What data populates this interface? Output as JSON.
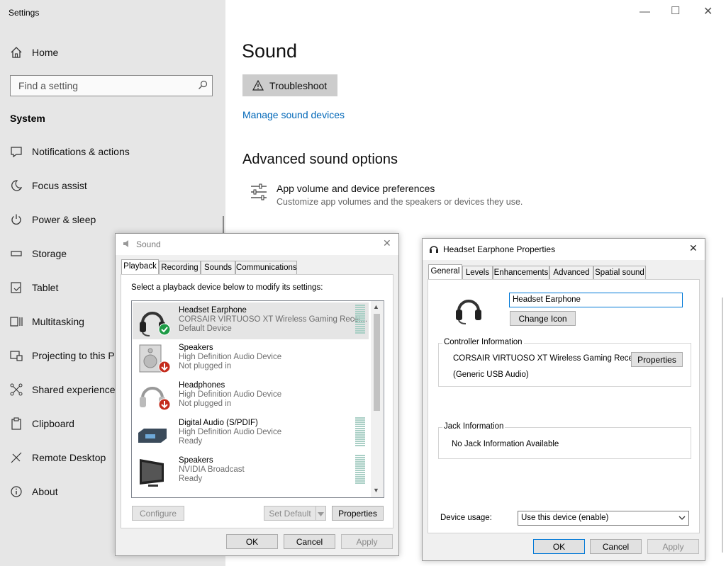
{
  "settings": {
    "app_title": "Settings",
    "home_label": "Home",
    "search_placeholder": "Find a setting",
    "section_title": "System",
    "nav_items": [
      {
        "label": "Notifications & actions",
        "icon": "notifications-icon"
      },
      {
        "label": "Focus assist",
        "icon": "moon-icon"
      },
      {
        "label": "Power & sleep",
        "icon": "power-icon"
      },
      {
        "label": "Storage",
        "icon": "storage-icon"
      },
      {
        "label": "Tablet",
        "icon": "tablet-icon"
      },
      {
        "label": "Multitasking",
        "icon": "multitasking-icon"
      },
      {
        "label": "Projecting to this PC",
        "icon": "projecting-icon"
      },
      {
        "label": "Shared experiences",
        "icon": "shared-icon"
      },
      {
        "label": "Clipboard",
        "icon": "clipboard-icon"
      },
      {
        "label": "Remote Desktop",
        "icon": "remote-desktop-icon"
      },
      {
        "label": "About",
        "icon": "info-icon"
      }
    ],
    "main": {
      "title": "Sound",
      "troubleshoot_label": "Troubleshoot",
      "manage_link": "Manage sound devices",
      "advanced_title": "Advanced sound options",
      "app_volume_title": "App volume and device preferences",
      "app_volume_subtitle": "Customize app volumes and the speakers or devices they use."
    }
  },
  "sound_dialog": {
    "title": "Sound",
    "tabs": [
      "Playback",
      "Recording",
      "Sounds",
      "Communications"
    ],
    "instruction": "Select a playback device below to modify its settings:",
    "devices": [
      {
        "name": "Headset Earphone",
        "subtitle": "CORSAIR VIRTUOSO XT Wireless Gaming Recei...",
        "status": "Default Device"
      },
      {
        "name": "Speakers",
        "subtitle": "High Definition Audio Device",
        "status": "Not plugged in"
      },
      {
        "name": "Headphones",
        "subtitle": "High Definition Audio Device",
        "status": "Not plugged in"
      },
      {
        "name": "Digital Audio (S/PDIF)",
        "subtitle": "High Definition Audio Device",
        "status": "Ready"
      },
      {
        "name": "Speakers",
        "subtitle": "NVIDIA Broadcast",
        "status": "Ready"
      }
    ],
    "buttons": {
      "configure": "Configure",
      "set_default": "Set Default",
      "properties": "Properties",
      "ok": "OK",
      "cancel": "Cancel",
      "apply": "Apply"
    }
  },
  "props_dialog": {
    "title": "Headset Earphone Properties",
    "tabs": [
      "General",
      "Levels",
      "Enhancements",
      "Advanced",
      "Spatial sound"
    ],
    "device_name_value": "Headset Earphone",
    "change_icon": "Change Icon",
    "controller_label": "Controller Information",
    "controller_name": "CORSAIR VIRTUOSO XT Wireless Gaming Recei...",
    "controller_properties": "Properties",
    "controller_driver": "(Generic USB Audio)",
    "jack_label": "Jack Information",
    "jack_value": "No Jack Information Available",
    "device_usage_label": "Device usage:",
    "device_usage_value": "Use this device (enable)",
    "buttons": {
      "ok": "OK",
      "cancel": "Cancel",
      "apply": "Apply"
    }
  },
  "colors": {
    "accent": "#0078d7",
    "link": "#0067b8",
    "sidebar_bg": "#e6e6e6",
    "selected_row": "#cce8ff"
  }
}
